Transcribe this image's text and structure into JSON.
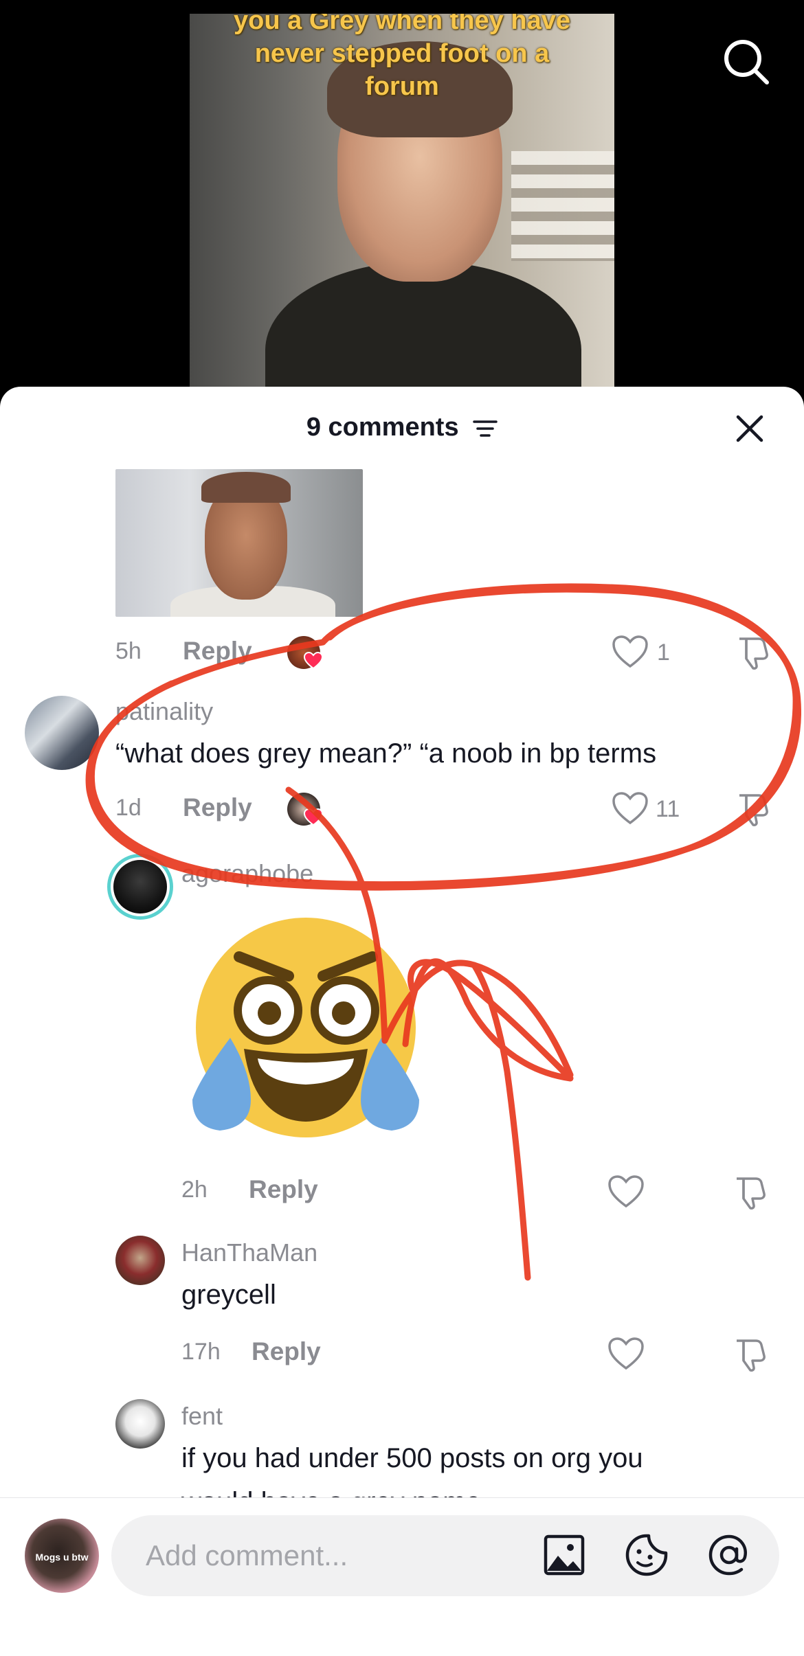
{
  "video": {
    "caption_line1": "you a Grey when they have",
    "caption_line2": "never stepped foot on a",
    "caption_line3": "forum",
    "search_icon": "search-icon"
  },
  "comments_panel": {
    "title": "9 comments",
    "sort_icon": "sort-icon",
    "close_icon": "close-icon"
  },
  "comments": [
    {
      "time": "5h",
      "reply_label": "Reply",
      "likes": "1",
      "has_photo": true
    },
    {
      "username": "patinality",
      "text": "“what does grey mean?” “a noob in bp terms",
      "time": "1d",
      "reply_label": "Reply",
      "likes": "11"
    },
    {
      "username": "agoraphobe",
      "sticker": "laughing-crying-emoji",
      "time": "2h",
      "reply_label": "Reply",
      "likes": ""
    },
    {
      "username": "HanThaMan",
      "text": "greycell",
      "time": "17h",
      "reply_label": "Reply",
      "likes": ""
    },
    {
      "username": "fent",
      "text": "if you had under 500 posts on org you",
      "text_line2": "would have a grey name",
      "likes": ""
    }
  ],
  "composer": {
    "avatar_text": "Mogs u btw",
    "placeholder": "Add comment...",
    "image_icon": "image-icon",
    "emoji_icon": "sticker-emoji-icon",
    "mention_icon": "mention-icon"
  },
  "colors": {
    "annotation_red": "#e8391f",
    "text_primary": "#161823",
    "text_muted": "#8a8b91",
    "caption_yellow": "#f7c64c",
    "heart_badge": "#fe2c55"
  }
}
